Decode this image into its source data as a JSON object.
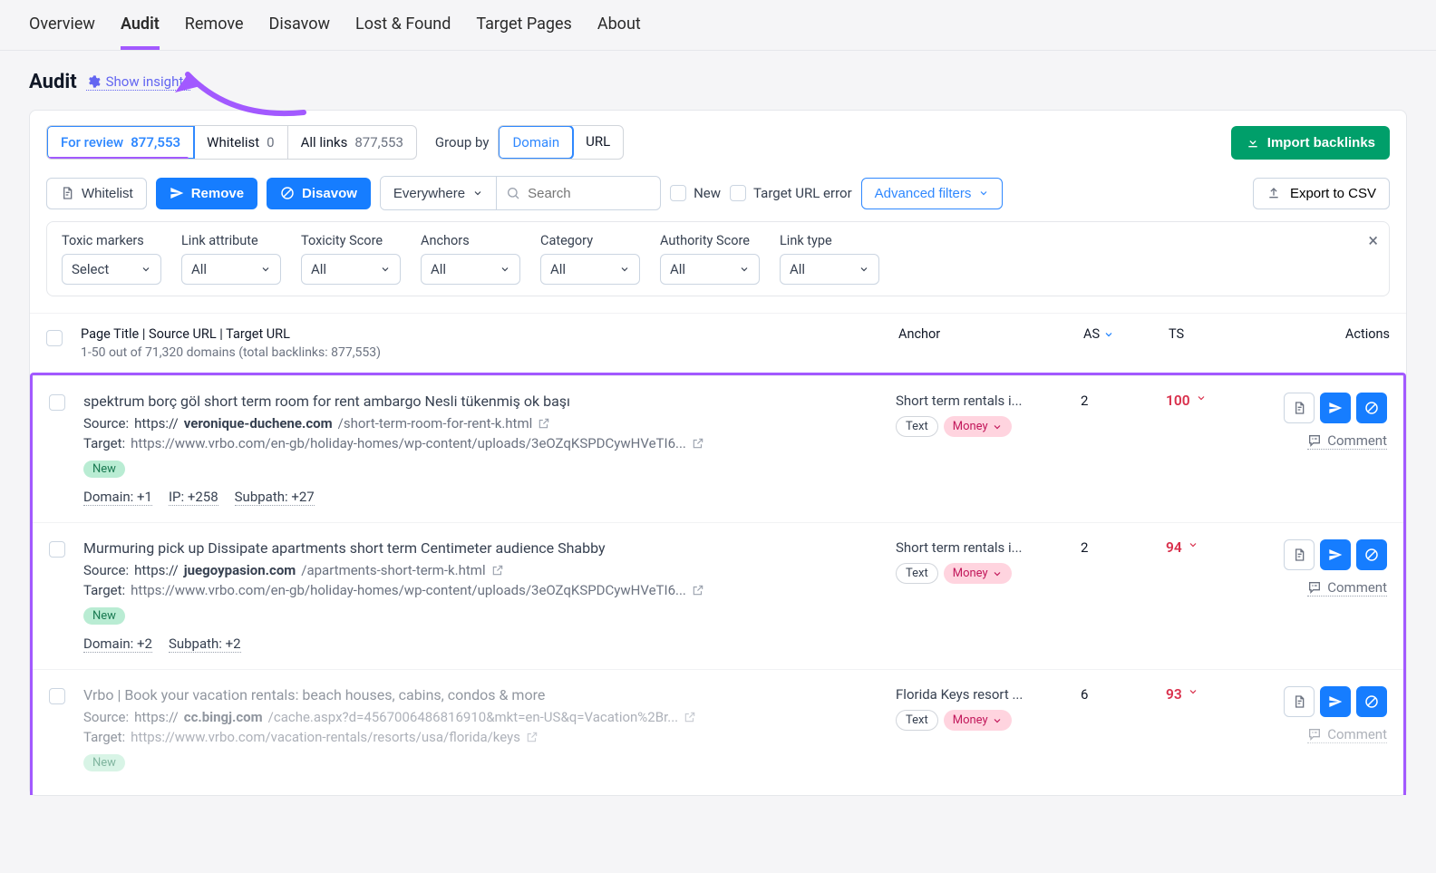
{
  "nav": {
    "items": [
      "Overview",
      "Audit",
      "Remove",
      "Disavow",
      "Lost & Found",
      "Target Pages",
      "About"
    ],
    "activeIndex": 1
  },
  "header": {
    "title": "Audit",
    "showInsights": "Show insights"
  },
  "segTabs": {
    "forReview": {
      "label": "For review",
      "count": "877,553"
    },
    "whitelist": {
      "label": "Whitelist",
      "count": "0"
    },
    "allLinks": {
      "label": "All links",
      "count": "877,553"
    }
  },
  "groupBy": {
    "label": "Group by",
    "domain": "Domain",
    "url": "URL"
  },
  "importBtn": "Import backlinks",
  "toolbar": {
    "whitelist": "Whitelist",
    "remove": "Remove",
    "disavow": "Disavow",
    "scope": "Everywhere",
    "searchPlaceholder": "Search",
    "new": "New",
    "targetUrlError": "Target URL error",
    "advancedFilters": "Advanced filters",
    "exportCsv": "Export to CSV"
  },
  "filters": {
    "toxicMarkers": {
      "label": "Toxic markers",
      "value": "Select"
    },
    "linkAttribute": {
      "label": "Link attribute",
      "value": "All"
    },
    "toxicityScore": {
      "label": "Toxicity Score",
      "value": "All"
    },
    "anchors": {
      "label": "Anchors",
      "value": "All"
    },
    "category": {
      "label": "Category",
      "value": "All"
    },
    "authorityScore": {
      "label": "Authority Score",
      "value": "All"
    },
    "linkType": {
      "label": "Link type",
      "value": "All"
    }
  },
  "tableHead": {
    "title": "Page Title | Source URL | Target URL",
    "subtitle": "1-50 out of 71,320 domains (total backlinks: 877,553)",
    "anchor": "Anchor",
    "as": "AS",
    "ts": "TS",
    "actions": "Actions"
  },
  "labels": {
    "source": "Source:",
    "target": "Target:",
    "new": "New",
    "text": "Text",
    "money": "Money",
    "comment": "Comment"
  },
  "rows": [
    {
      "title": "spektrum borç göl short term room for rent ambargo Nesli tükenmiş ok başı",
      "sourcePrefix": "https://",
      "sourceBold": "veronique-duchene.com",
      "sourceRest": "/short-term-room-for-rent-k.html",
      "target": "https://www.vrbo.com/en-gb/holiday-homes/wp-content/uploads/3eOZqKSPDCywHVeTI6...",
      "domainMeta": "Domain: +1",
      "ipMeta": "IP: +258",
      "subpathMeta": "Subpath: +27",
      "anchor": "Short term rentals i...",
      "as": "2",
      "ts": "100"
    },
    {
      "title": "Murmuring pick up Dissipate apartments short term Centimeter audience Shabby",
      "sourcePrefix": "https://",
      "sourceBold": "juegoypasion.com",
      "sourceRest": "/apartments-short-term-k.html",
      "target": "https://www.vrbo.com/en-gb/holiday-homes/wp-content/uploads/3eOZqKSPDCywHVeTI6...",
      "domainMeta": "Domain: +2",
      "ipMeta": "",
      "subpathMeta": "Subpath: +2",
      "anchor": "Short term rentals i...",
      "as": "2",
      "ts": "94"
    },
    {
      "title": "Vrbo | Book your vacation rentals: beach houses, cabins, condos & more",
      "sourcePrefix": "https://",
      "sourceBold": "cc.bingj.com",
      "sourceRest": "/cache.aspx?d=4567006486816910&mkt=en-US&q=Vacation%2Br...",
      "target": "https://www.vrbo.com/vacation-rentals/resorts/usa/florida/keys",
      "domainMeta": "",
      "ipMeta": "",
      "subpathMeta": "",
      "anchor": "Florida Keys resort ...",
      "as": "6",
      "ts": "93"
    }
  ]
}
